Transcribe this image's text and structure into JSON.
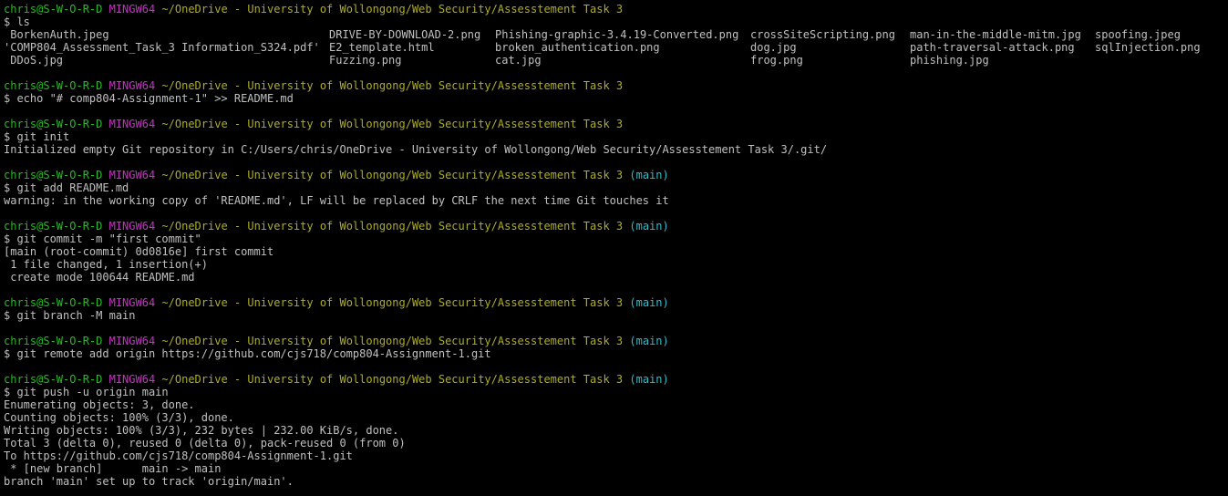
{
  "terminal": {
    "colors": {
      "background": "#000000",
      "text": "#c0c0c0",
      "user_host": "#25bc24",
      "shell": "#c930c7",
      "path": "#adad27",
      "branch": "#33bbc8"
    },
    "prompt": {
      "user_host": "chris@S-W-O-R-D",
      "shell": "MINGW64",
      "path": "~/OneDrive - University of Wollongong/Web Security/Assesstement Task 3",
      "branch": "(main)"
    },
    "blocks": [
      {
        "has_branch": false,
        "command": "$ ls",
        "ls_rows": [
          [
            " BorkenAuth.jpeg",
            "DRIVE-BY-DOWNLOAD-2.png",
            "Phishing-graphic-3.4.19-Converted.png",
            "crossSiteScripting.png",
            "man-in-the-middle-mitm.jpg",
            "spoofing.jpeg"
          ],
          [
            "'COMP804_Assessment_Task_3 Information_S324.pdf'",
            "E2_template.html",
            "broken_authentication.png",
            "dog.jpg",
            "path-traversal-attack.png",
            "sqlInjection.png"
          ],
          [
            " DDoS.jpg",
            "Fuzzing.png",
            "cat.jpg",
            "frog.png",
            "phishing.jpg",
            ""
          ]
        ]
      },
      {
        "has_branch": false,
        "command": "$ echo \"# comp804-Assignment-1\" >> README.md",
        "output": []
      },
      {
        "has_branch": false,
        "command": "$ git init",
        "output": [
          "Initialized empty Git repository in C:/Users/chris/OneDrive - University of Wollongong/Web Security/Assesstement Task 3/.git/"
        ]
      },
      {
        "has_branch": true,
        "command": "$ git add README.md",
        "output": [
          "warning: in the working copy of 'README.md', LF will be replaced by CRLF the next time Git touches it"
        ]
      },
      {
        "has_branch": true,
        "command": "$ git commit -m \"first commit\"",
        "output": [
          "[main (root-commit) 0d0816e] first commit",
          " 1 file changed, 1 insertion(+)",
          " create mode 100644 README.md"
        ]
      },
      {
        "has_branch": true,
        "command": "$ git branch -M main",
        "output": []
      },
      {
        "has_branch": true,
        "command": "$ git remote add origin https://github.com/cjs718/comp804-Assignment-1.git",
        "output": []
      },
      {
        "has_branch": true,
        "command": "$ git push -u origin main",
        "output": [
          "Enumerating objects: 3, done.",
          "Counting objects: 100% (3/3), done.",
          "Writing objects: 100% (3/3), 232 bytes | 232.00 KiB/s, done.",
          "Total 3 (delta 0), reused 0 (delta 0), pack-reused 0 (from 0)",
          "To https://github.com/cjs718/comp804-Assignment-1.git",
          " * [new branch]      main -> main",
          "branch 'main' set up to track 'origin/main'."
        ]
      }
    ]
  }
}
